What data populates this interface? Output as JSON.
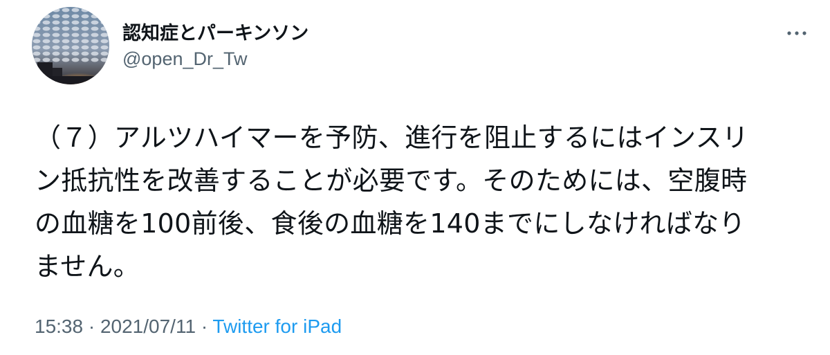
{
  "author": {
    "name": "認知症とパーキンソン",
    "handle": "@open_Dr_Tw"
  },
  "tweet": {
    "text_lines": [
      "（７）アルツハイマーを予防、進行を阻止するにはインスリ",
      "ン抵抗性を改善することが必要です。そのためには、空腹時",
      "の血糖を100前後、食後の血糖を140までにしなければなり",
      "ません。"
    ]
  },
  "meta": {
    "time": "15:38",
    "separator": "·",
    "date": "2021/07/11",
    "source": "Twitter for iPad"
  },
  "icons": {
    "more": "more-horizontal-icon",
    "avatar": "cloudy-sky-photo"
  },
  "colors": {
    "link": "#1d9bf0",
    "secondary_text": "#536471",
    "primary_text": "#0f1419"
  }
}
